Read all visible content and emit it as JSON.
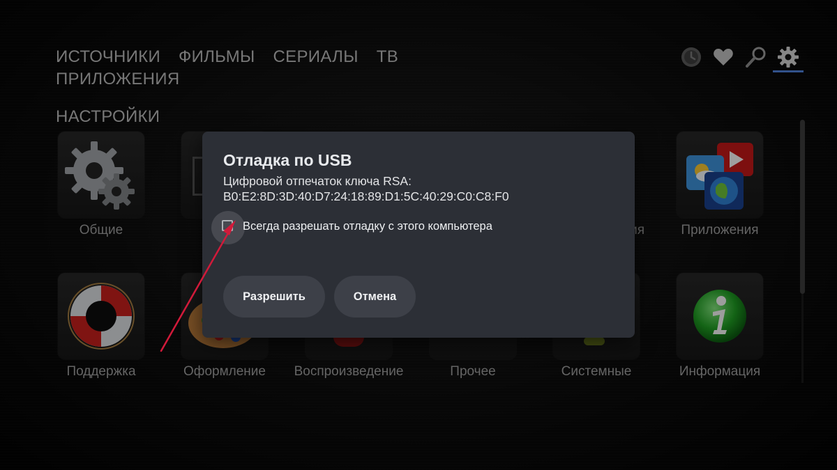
{
  "nav": {
    "items": [
      {
        "label": "ИСТОЧНИКИ"
      },
      {
        "label": "ФИЛЬМЫ"
      },
      {
        "label": "СЕРИАЛЫ"
      },
      {
        "label": "ТВ"
      },
      {
        "label": "ПРИЛОЖЕНИЯ"
      }
    ],
    "settings_label": "НАСТРОЙКИ",
    "icons": [
      "history-icon",
      "favorites-heart-icon",
      "search-icon",
      "settings-gear-icon"
    ],
    "active_indicator_color": "#4d7fd6"
  },
  "tiles_row1": {
    "general": "Общие",
    "apps": "Приложения",
    "partial_right": "ия"
  },
  "tiles_row2": {
    "support": "Поддержка",
    "appearance": "Оформление",
    "playback": "Воспроизведение",
    "other": "Прочее",
    "system": "Системные",
    "info": "Информация"
  },
  "dialog": {
    "title": "Отладка по USB",
    "message_line1": "Цифровой отпечаток ключа RSA:",
    "message_line2": "B0:E2:8D:3D:40:D7:24:18:89:D1:5C:40:29:C0:C8:F0",
    "checkbox_label": "Всегда разрешать отладку с этого компьютера",
    "checkbox_checked": false,
    "allow_button": "Разрешить",
    "cancel_button": "Отмена"
  },
  "colors": {
    "dialog_bg": "#2c2f36",
    "button_bg": "#3d4048",
    "annotation_arrow": "#d11a3a"
  }
}
